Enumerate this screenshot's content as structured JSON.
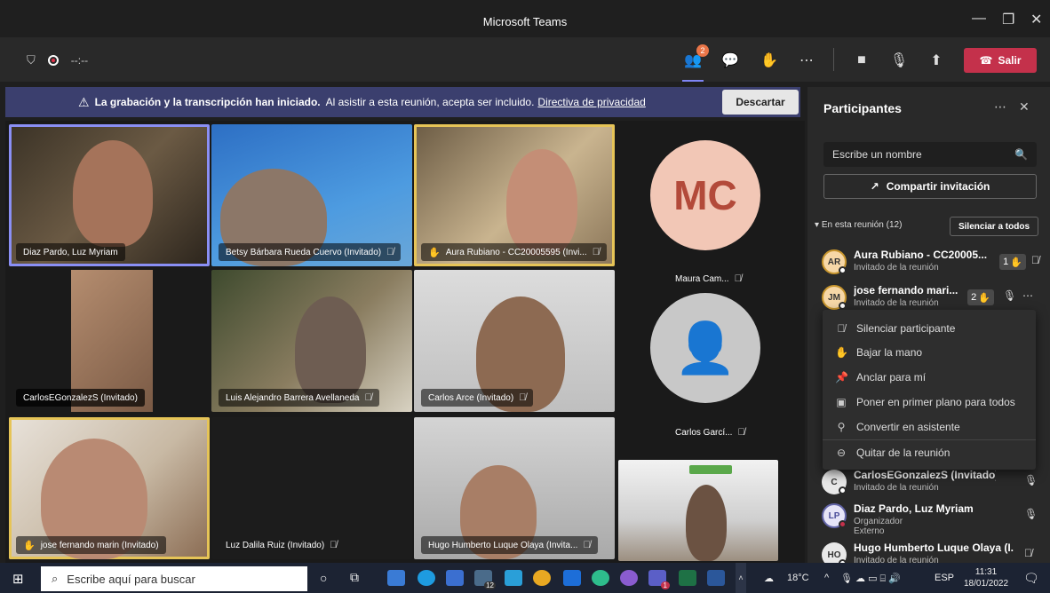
{
  "window": {
    "title": "Microsoft Teams"
  },
  "toolbar": {
    "timer": "--:--",
    "participants_badge": "2",
    "leave_label": "Salir"
  },
  "banner": {
    "bold": "La grabación y la transcripción han iniciado.",
    "text": "Al asistir a esta reunión, acepta ser incluido.",
    "link": "Directiva de privacidad",
    "dismiss": "Descartar"
  },
  "tiles": [
    {
      "name": "Diaz Pardo, Luz Myriam"
    },
    {
      "name": "Betsy Bárbara Rueda Cuervo (Invitado)"
    },
    {
      "name": "Aura Rubiano - CC20005595 (Invi..."
    },
    {
      "name": "CarlosEGonzalezS (Invitado)"
    },
    {
      "name": "Luis Alejandro Barrera Avellaneda"
    },
    {
      "name": "Carlos Arce (Invitado)"
    },
    {
      "name": "jose fernando marin (Invitado)"
    },
    {
      "name": "Luz Dalila Ruiz (Invitado)"
    },
    {
      "name": "Hugo Humberto Luque Olaya (Invita..."
    }
  ],
  "avatar_tiles": [
    {
      "initials": "MC",
      "name": "Maura Cam..."
    },
    {
      "name": "Carlos Garcí..."
    }
  ],
  "panel": {
    "title": "Participantes",
    "search_placeholder": "Escribe un nombre",
    "share_label": "Compartir invitación",
    "section_label": "En esta reunión (12)",
    "mute_all": "Silenciar a todos",
    "participants": [
      {
        "initials": "AR",
        "name": "Aura Rubiano - CC20005...",
        "role": "Invitado de la reunión",
        "hand": "1"
      },
      {
        "initials": "JM",
        "name": "jose fernando mari...",
        "role": "Invitado de la reunión",
        "hand": "2"
      },
      {
        "initials": "C",
        "name": "CarlosEGonzalezS (Invitado)",
        "role": "Invitado de la reunión"
      },
      {
        "initials": "LP",
        "name": "Diaz Pardo, Luz Myriam",
        "role": "Organizador",
        "role2": "Externo"
      },
      {
        "initials": "HO",
        "name": "Hugo Humberto Luque Olaya (I...",
        "role": "Invitado de la reunión"
      }
    ]
  },
  "context_menu": [
    {
      "icon": "mic-off-icon",
      "label": "Silenciar participante"
    },
    {
      "icon": "hand-icon",
      "label": "Bajar la mano"
    },
    {
      "icon": "pin-icon",
      "label": "Anclar para mí"
    },
    {
      "icon": "spotlight-icon",
      "label": "Poner en primer plano para todos"
    },
    {
      "icon": "attendee-icon",
      "label": "Convertir en asistente"
    },
    {
      "icon": "remove-person-icon",
      "label": "Quitar de la reunión"
    }
  ],
  "taskbar": {
    "search_placeholder": "Escribe aquí para buscar",
    "weather": "18°C",
    "lang": "ESP",
    "time": "11:31",
    "date": "18/01/2022",
    "teams_badge": "1",
    "mail_badge": "12"
  },
  "colors": {
    "accent": "#7f85f5",
    "leave": "#c4314b",
    "raised_hand": "#f3c43a",
    "speaking_border": "#e6c457"
  }
}
